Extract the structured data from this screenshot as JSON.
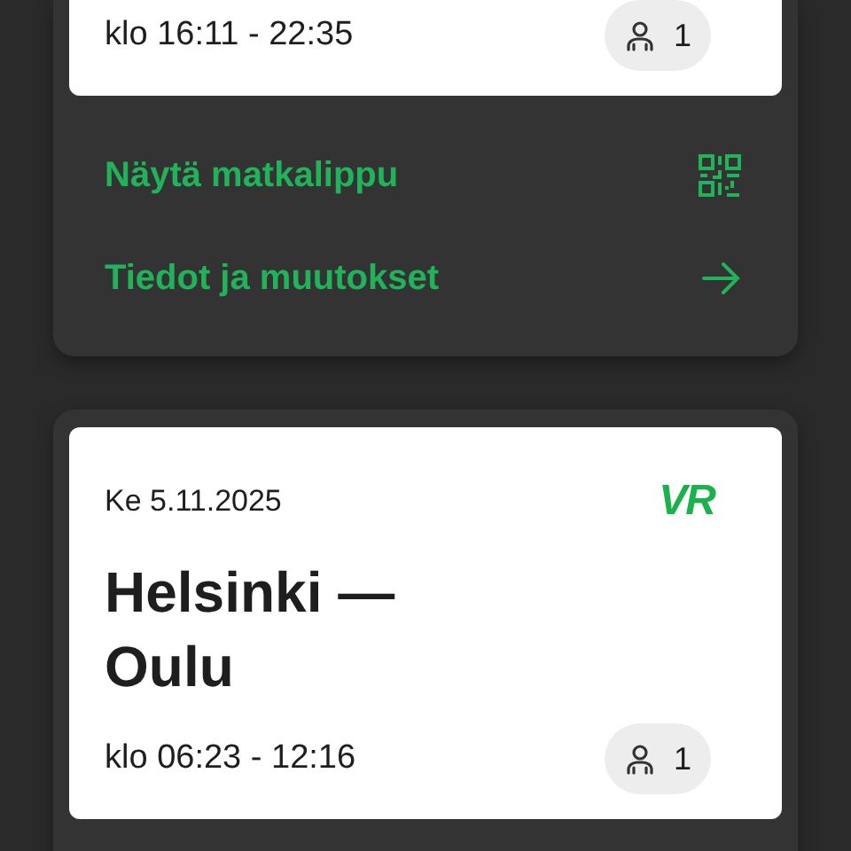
{
  "trips": [
    {
      "time": "klo 16:11 - 22:35",
      "passengers": "1",
      "actions": [
        {
          "label": "Näytä matkalippu",
          "kind": "qr"
        },
        {
          "label": "Tiedot ja muutokset",
          "kind": "arrow"
        }
      ]
    },
    {
      "date": "Ke 5.11.2025",
      "logo": "VR",
      "title": "Helsinki — Oulu",
      "time": "klo 06:23 - 12:16",
      "passengers": "1"
    }
  ]
}
